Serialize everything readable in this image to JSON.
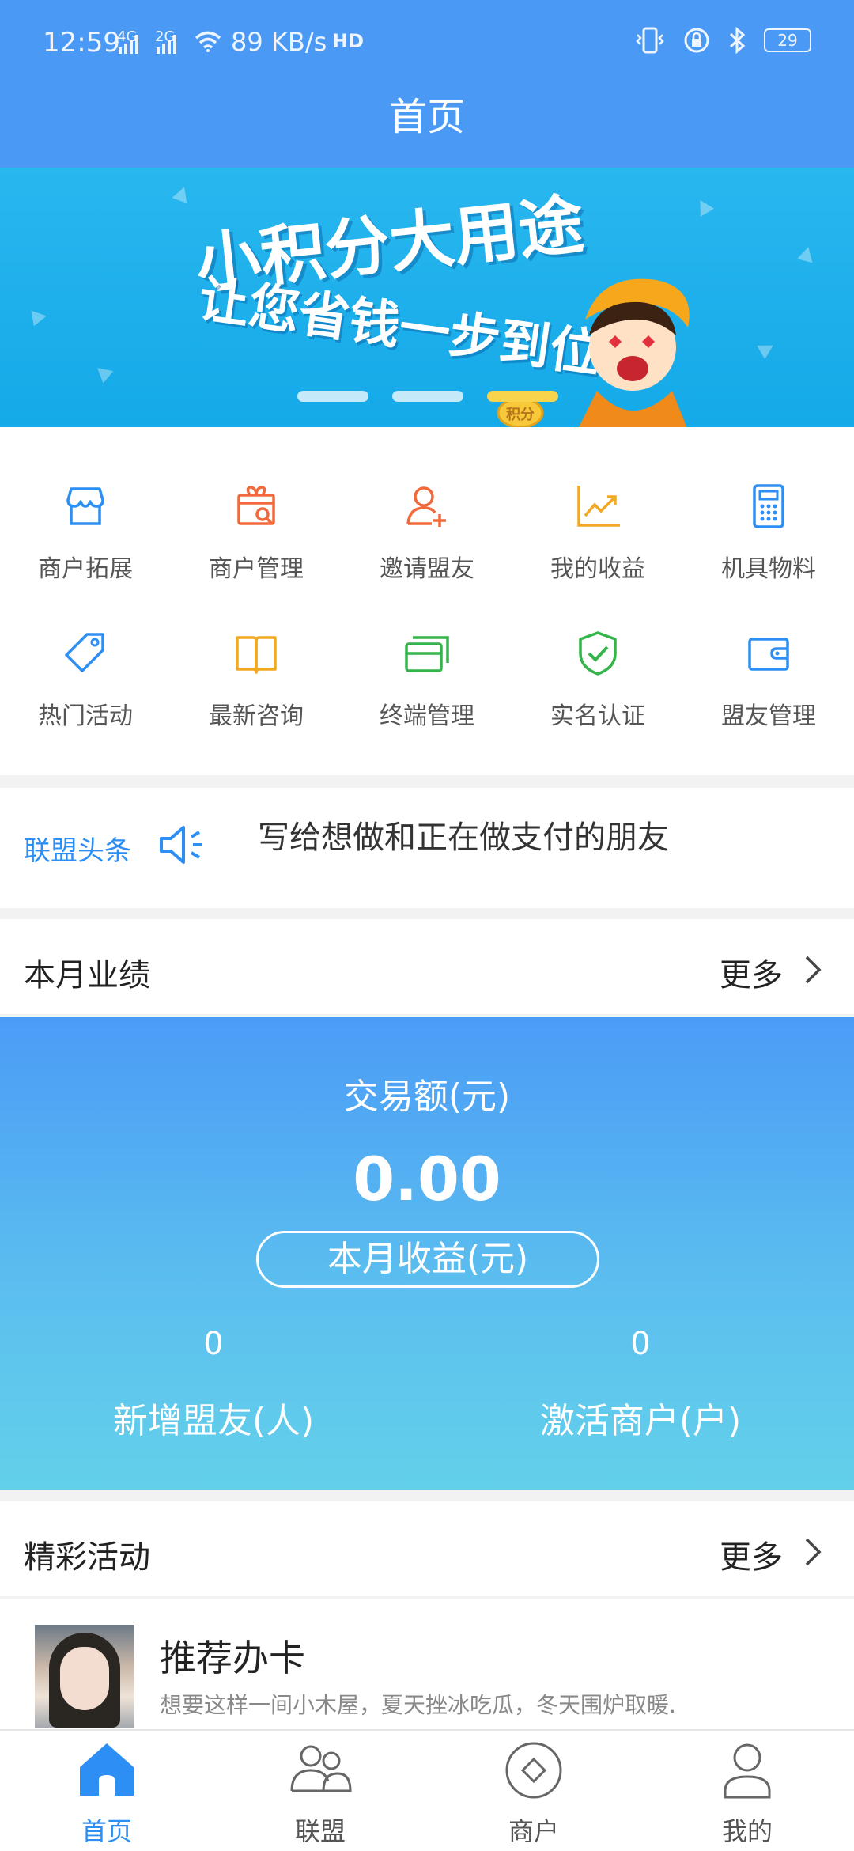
{
  "status_bar": {
    "time": "12:59",
    "sig1": "4G",
    "sig2": "2G",
    "speed": "89 KB/s",
    "hd": "HD",
    "battery": "29"
  },
  "header": {
    "title": "首页"
  },
  "banner": {
    "line1": "小积分大用途",
    "line2": "让您省钱一步到位",
    "badge": "积分",
    "active_dot": 2
  },
  "grid": {
    "items": [
      {
        "label": "商户拓展",
        "icon": "store-icon",
        "color": "#2d8ff3"
      },
      {
        "label": "商户管理",
        "icon": "gift-search-icon",
        "color": "#f26a3b"
      },
      {
        "label": "邀请盟友",
        "icon": "add-user-icon",
        "color": "#f26a3b"
      },
      {
        "label": "我的收益",
        "icon": "chart-line-icon",
        "color": "#f3a821"
      },
      {
        "label": "机具物料",
        "icon": "calculator-icon",
        "color": "#2d8ff3"
      },
      {
        "label": "热门活动",
        "icon": "tag-icon",
        "color": "#2d8ff3"
      },
      {
        "label": "最新咨询",
        "icon": "book-icon",
        "color": "#f3a821"
      },
      {
        "label": "终端管理",
        "icon": "cards-icon",
        "color": "#34b44a"
      },
      {
        "label": "实名认证",
        "icon": "shield-check-icon",
        "color": "#34b44a"
      },
      {
        "label": "盟友管理",
        "icon": "wallet-icon",
        "color": "#2d8ff3"
      }
    ]
  },
  "headline": {
    "tag": "联盟头条",
    "text": "写给想做和正在做支付的朋友"
  },
  "monthly": {
    "title": "本月业绩",
    "more": "更多",
    "caption": "交易额(元)",
    "amount": "0.00",
    "income_label": "本月收益(元)",
    "new_allies_value": "0",
    "new_allies_label": "新增盟友(人)",
    "active_merchants_value": "0",
    "active_merchants_label": "激活商户(户)"
  },
  "activities": {
    "title": "精彩活动",
    "more": "更多",
    "card": {
      "title": "推荐办卡",
      "desc": "想要这样一间小木屋，夏天挫冰吃瓜，冬天围炉取暖."
    }
  },
  "bottom_nav": {
    "items": [
      {
        "label": "首页",
        "icon": "home-icon",
        "active": true
      },
      {
        "label": "联盟",
        "icon": "users-icon",
        "active": false
      },
      {
        "label": "商户",
        "icon": "diamond-circle-icon",
        "active": false
      },
      {
        "label": "我的",
        "icon": "user-icon",
        "active": false
      }
    ]
  },
  "colors": {
    "primary": "#4a9af5",
    "accent_text": "#2d8ff3",
    "gradient_end": "#63d0ea"
  }
}
